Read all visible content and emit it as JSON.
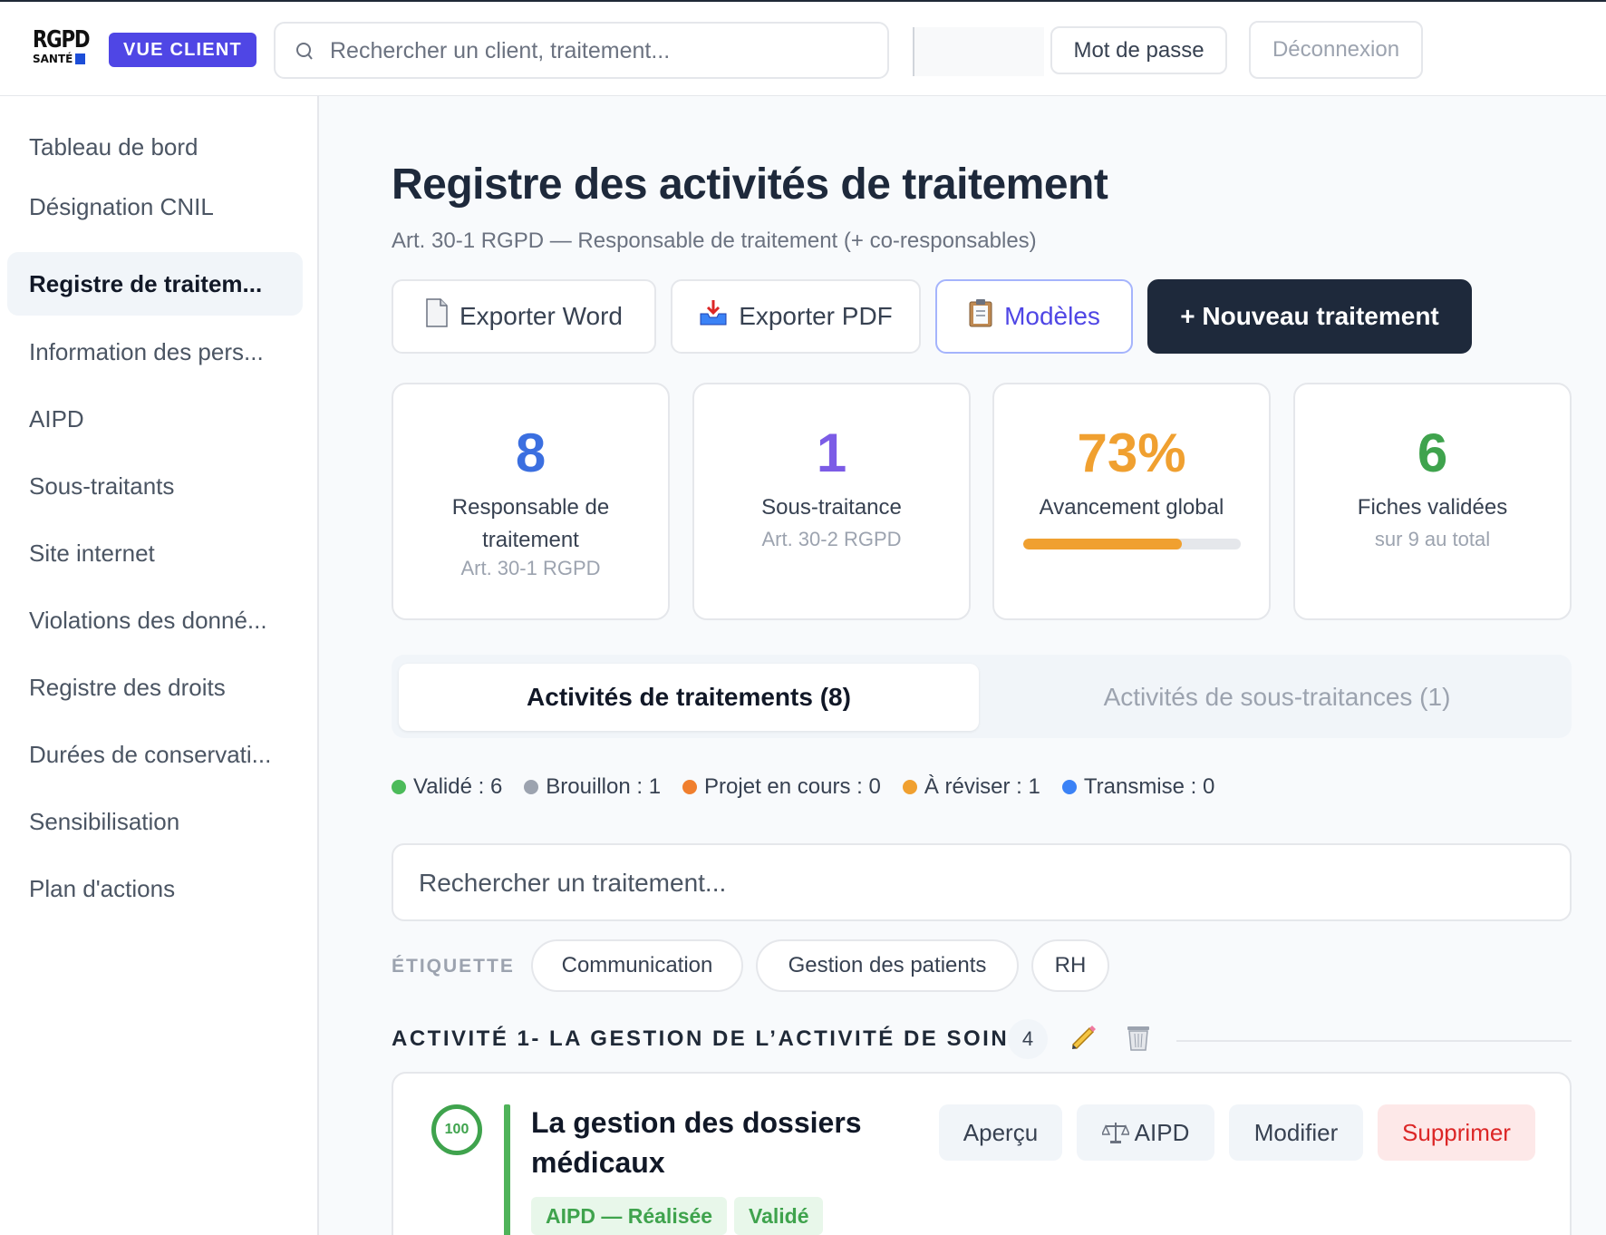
{
  "header": {
    "logo_line1": "RGPD",
    "logo_line2": "SANTÉ",
    "client_badge": "VUE CLIENT",
    "search_placeholder": "Rechercher un client, traitement...",
    "password_button": "Mot de passe",
    "logout_button": "Déconnexion"
  },
  "sidebar": {
    "items": [
      {
        "label": "Tableau de bord",
        "active": false
      },
      {
        "label": "Désignation CNIL",
        "active": false
      },
      {
        "label": "Registre de traitem...",
        "active": true
      },
      {
        "label": "Information des pers...",
        "active": false
      },
      {
        "label": "AIPD",
        "active": false
      },
      {
        "label": "Sous-traitants",
        "active": false
      },
      {
        "label": "Site internet",
        "active": false
      },
      {
        "label": "Violations des donné...",
        "active": false
      },
      {
        "label": "Registre des droits",
        "active": false
      },
      {
        "label": "Durées de conservati...",
        "active": false
      },
      {
        "label": "Sensibilisation",
        "active": false
      },
      {
        "label": "Plan d'actions",
        "active": false
      }
    ]
  },
  "main": {
    "title": "Registre des activités de traitement",
    "subtitle": "Art. 30-1 RGPD — Responsable de traitement (+ co-responsables)",
    "actions": {
      "export_word": "Exporter Word",
      "export_pdf": "Exporter PDF",
      "templates": "Modèles",
      "new_processing": "+ Nouveau traitement"
    },
    "stats": [
      {
        "value": "8",
        "label": "Responsable de traitement",
        "sub": "Art. 30-1 RGPD",
        "color": "#3b6fe0"
      },
      {
        "value": "1",
        "label": "Sous-traitance",
        "sub": "Art. 30-2 RGPD",
        "color": "#7c5ce6"
      },
      {
        "value": "73%",
        "label": "Avancement global",
        "progress": 0.73,
        "color": "#f0a030"
      },
      {
        "value": "6",
        "label": "Fiches validées",
        "sub": "sur 9 au total",
        "color": "#3fa34d"
      }
    ],
    "tabs": {
      "active": "Activités de traitements (8)",
      "inactive": "Activités de sous-traitances (1)"
    },
    "legend": [
      {
        "label": "Validé : 6",
        "color": "#4cbb5a"
      },
      {
        "label": "Brouillon : 1",
        "color": "#9ca3af"
      },
      {
        "label": "Projet en cours : 0",
        "color": "#f07f2e"
      },
      {
        "label": "À réviser : 1",
        "color": "#f0a030"
      },
      {
        "label": "Transmise : 0",
        "color": "#3b82f6"
      }
    ],
    "search_placeholder": "Rechercher un traitement...",
    "tag_label": "ÉTIQUETTE",
    "tags": [
      "Communication",
      "Gestion des patients",
      "RH"
    ],
    "group": {
      "title": "ACTIVITÉ 1- LA GESTION DE L’ACTIVITÉ DE SOINS",
      "count": "4"
    },
    "card": {
      "score": "100",
      "title": "La gestion des dossiers médicaux",
      "pills": [
        "AIPD — Réalisée",
        "Validé"
      ],
      "buttons": {
        "preview": "Aperçu",
        "aipd": "AIPD",
        "edit": "Modifier",
        "delete": "Supprimer"
      }
    }
  }
}
